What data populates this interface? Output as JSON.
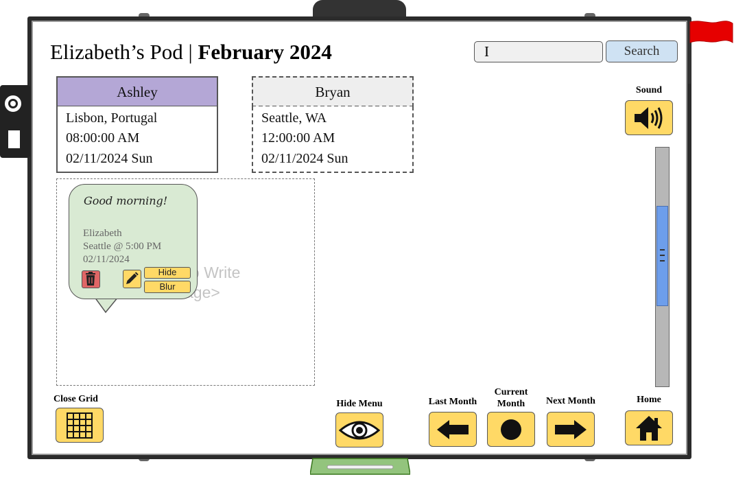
{
  "header": {
    "title_prefix": "Elizabeth’s Pod | ",
    "title_month": "February 2024",
    "search_value": "I",
    "search_label": "Search"
  },
  "members": [
    {
      "name": "Ashley",
      "location": "Lisbon, Portugal",
      "time": "08:00:00 AM",
      "date": "02/11/2024 Sun",
      "color": "#b4a7d6"
    },
    {
      "name": "Bryan",
      "location": "Seattle, WA",
      "time": "12:00:00 AM",
      "date": "02/11/2024 Sun",
      "color": "#eeeeee"
    }
  ],
  "message_area": {
    "placeholder_line1": "ere to Write",
    "placeholder_line2": "ssage>"
  },
  "note": {
    "greeting": "Good morning!",
    "author": "Elizabeth",
    "location_time": "Seattle @ 5:00 PM",
    "date": "02/11/2024",
    "hide_label": "Hide",
    "blur_label": "Blur",
    "color": "#d9ead3"
  },
  "controls": {
    "sound_label": "Sound",
    "close_grid_label": "Close Grid",
    "hide_menu_label": "Hide Menu",
    "last_month_label": "Last Month",
    "current_month_label_1": "Current",
    "current_month_label_2": "Month",
    "next_month_label": "Next Month",
    "home_label": "Home"
  },
  "colors": {
    "button_yellow": "#ffd966",
    "search_blue": "#cfe2f3",
    "scroll_thumb": "#6d9eeb",
    "flag_red": "#e60000",
    "tray_green": "#93c47d"
  }
}
